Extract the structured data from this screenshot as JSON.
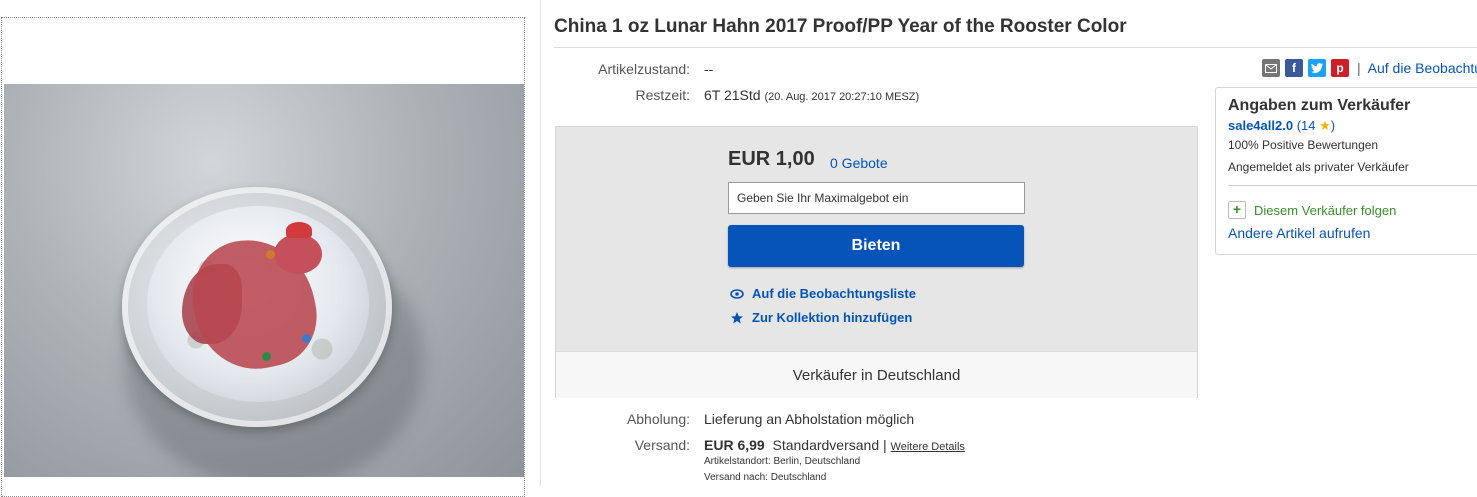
{
  "listing": {
    "title": "China 1 oz Lunar Hahn 2017 Proof/PP Year of the Rooster Color",
    "condition_label": "Artikelzustand:",
    "condition_value": "--",
    "time_left_label": "Restzeit:",
    "time_left_value": "6T 21Std",
    "time_left_end": "(20. Aug. 2017   20:27:10 MESZ)"
  },
  "bid": {
    "price": "EUR 1,00",
    "bids_count": "0 Gebote",
    "input_placeholder": "Geben Sie Ihr Maximalgebot ein",
    "button_label": "Bieten",
    "watch_label": "Auf die Beobachtungsliste",
    "collection_label": "Zur Kollektion hinzufügen",
    "seller_location": "Verkäufer in Deutschland"
  },
  "share": {
    "icons": [
      "email-icon",
      "facebook-icon",
      "twitter-icon",
      "pinterest-icon"
    ],
    "separator": "|",
    "watch_link": "Auf die Beobachtu"
  },
  "seller": {
    "heading": "Angaben zum Verkäufer",
    "name": "sale4all2.0",
    "feedback_open": "(14",
    "feedback_close": ")",
    "positive": "100% Positive Bewertungen",
    "type": "Angemeldet als privater Verkäufer",
    "follow": "Diesem Verkäufer folgen",
    "other_items": "Andere Artikel aufrufen"
  },
  "pickup": {
    "label": "Abholung:",
    "value": "Lieferung an Abholstation möglich"
  },
  "shipping": {
    "label": "Versand:",
    "price": "EUR 6,99",
    "method": "Standardversand |",
    "details_link": "Weitere Details",
    "location": "Artikelstandort:  Berlin, Deutschland",
    "ships_to": "Versand nach:  Deutschland"
  },
  "colors": {
    "link_blue": "#0654ba",
    "button_blue": "#0654ba",
    "follow_green": "#3a8f2a",
    "star": "#f4b400"
  }
}
